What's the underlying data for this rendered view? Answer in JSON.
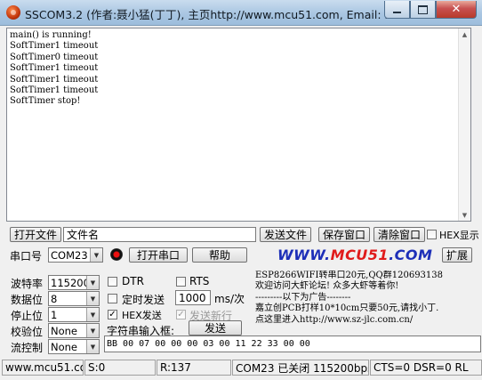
{
  "window": {
    "title": "SSCOM3.2 (作者:聂小猛(丁丁), 主页http://www.mcu51.com,  Email: mc...",
    "app_icon": "sscom-logo-icon",
    "buttons": {
      "minimize": "minimize-icon",
      "maximize": "maximize-icon",
      "close": "✕"
    }
  },
  "receive": {
    "lines": "main() is running!\nSoftTimer1 timeout\nSoftTimer0 timeout\nSoftTimer1 timeout\nSoftTimer1 timeout\nSoftTimer1 timeout\nSoftTimer stop!"
  },
  "file_row": {
    "open_file": "打开文件",
    "filename": "文件名",
    "send_file": "发送文件",
    "save_window": "保存窗口",
    "clear_window": "清除窗口",
    "hex_display": "HEX显示"
  },
  "port_row": {
    "port_label": "串口号",
    "port_value": "COM23",
    "open_port": "打开串口",
    "help": "帮助",
    "logo_left": "WWW.",
    "logo_mid": "MCU51",
    "logo_right": ".COM",
    "expand": "扩展"
  },
  "settings": {
    "baud_label": "波特率",
    "baud_value": "115200",
    "databits_label": "数据位",
    "databits_value": "8",
    "stopbits_label": "停止位",
    "stopbits_value": "1",
    "parity_label": "校验位",
    "parity_value": "None",
    "flow_label": "流控制",
    "flow_value": "None"
  },
  "options": {
    "dtr": "DTR",
    "rts": "RTS",
    "timed_send": "定时发送",
    "interval": "1000",
    "interval_unit": "ms/次",
    "hex_send": "HEX发送",
    "hex_send_checked": true,
    "newline_send": "发送新行",
    "newline_send_checked": true,
    "input_label": "字符串输入框:",
    "send": "发送"
  },
  "ad": {
    "text": "ESP8266WIFI转串口20元,QQ群120693138\n欢迎访问大虾论坛! 众多大虾等着你!\n---------以下为广告--------\n嘉立创PCB打样10*10cm只要50元,请找小丁.\n点这里进入http://www.sz-jlc.com.cn/"
  },
  "send_input": {
    "value": "BB 00 07 00 00 00 03 00 11 22 33 00 00"
  },
  "status": {
    "site": "www.mcu51.cor",
    "sent": "S:0",
    "received": "R:137",
    "port_state": "COM23 已关闭  115200bps",
    "lines": "CTS=0 DSR=0 RL"
  }
}
